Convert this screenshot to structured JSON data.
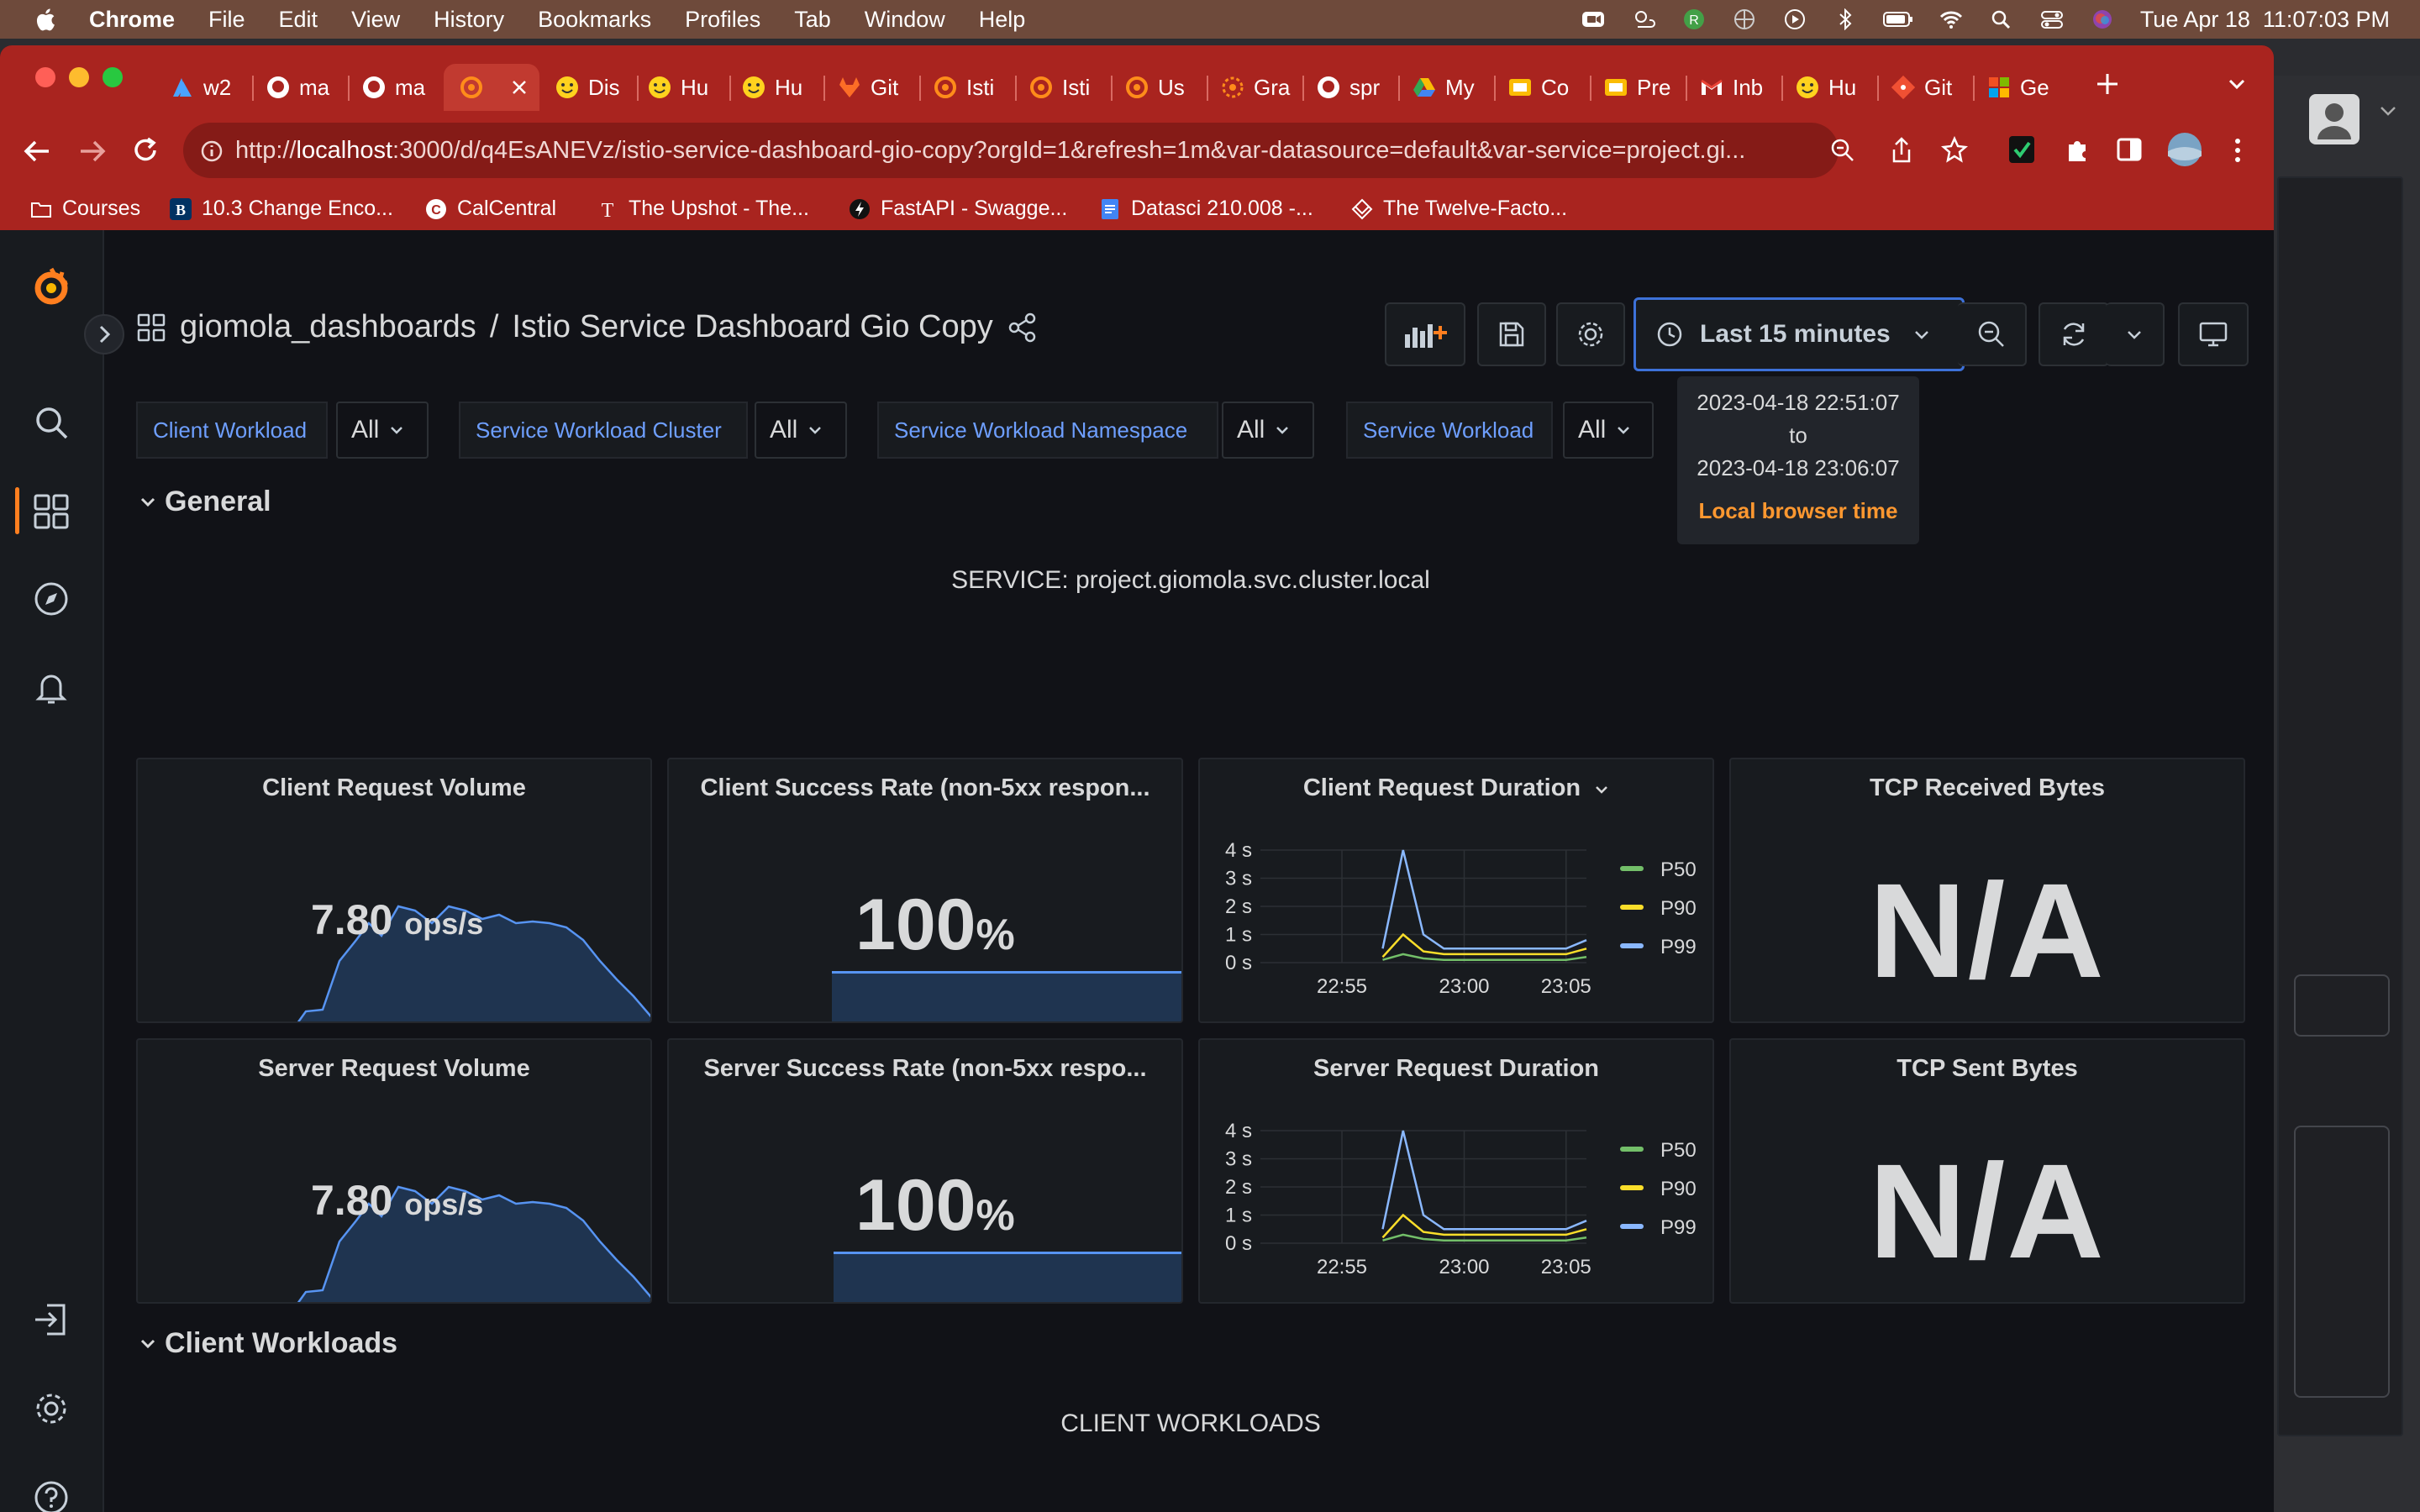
{
  "menubar": {
    "app": "Chrome",
    "items": [
      "File",
      "Edit",
      "View",
      "History",
      "Bookmarks",
      "Profiles",
      "Tab",
      "Window",
      "Help"
    ],
    "status_icons": [
      "zoom-icon",
      "weather-icon",
      "user-r-icon",
      "vpn-icon",
      "play-icon",
      "bluetooth-icon",
      "battery-icon",
      "wifi-icon",
      "spotlight-icon",
      "control-center-icon",
      "siri-icon"
    ],
    "datetime": "Tue Apr 18  11:07:03 PM"
  },
  "tabs": [
    {
      "label": "w2",
      "icon": "azure-icon"
    },
    {
      "label": "ma",
      "icon": "github-icon"
    },
    {
      "label": "ma",
      "icon": "github-icon"
    },
    {
      "label": "",
      "icon": "grafana-icon",
      "active": true
    },
    {
      "label": "Dis",
      "icon": "huggingface-icon"
    },
    {
      "label": "Hu",
      "icon": "huggingface-icon"
    },
    {
      "label": "Hu",
      "icon": "huggingface-icon"
    },
    {
      "label": "Git",
      "icon": "gitlab-icon"
    },
    {
      "label": "Isti",
      "icon": "grafana-icon"
    },
    {
      "label": "Isti",
      "icon": "grafana-icon"
    },
    {
      "label": "Us",
      "icon": "grafana-icon"
    },
    {
      "label": "Gra",
      "icon": "grafana-icon"
    },
    {
      "label": "spr",
      "icon": "github-icon"
    },
    {
      "label": "My",
      "icon": "drive-icon"
    },
    {
      "label": "Co",
      "icon": "slides-icon"
    },
    {
      "label": "Pre",
      "icon": "slides-icon"
    },
    {
      "label": "Inb",
      "icon": "gmail-icon"
    },
    {
      "label": "Hu",
      "icon": "huggingface-icon"
    },
    {
      "label": "Git",
      "icon": "git-icon"
    },
    {
      "label": "Ge",
      "icon": "microsoft-icon"
    }
  ],
  "url": {
    "prefix": "http://",
    "host": "localhost",
    "rest": ":3000/d/q4EsANEVz/istio-service-dashboard-gio-copy?orgId=1&refresh=1m&var-datasource=default&var-service=project.gi..."
  },
  "bookmarks": [
    {
      "label": "Courses",
      "icon": "folder-icon"
    },
    {
      "label": "10.3 Change Enco...",
      "icon": "berkeley-icon"
    },
    {
      "label": "CalCentral",
      "icon": "calcentral-icon"
    },
    {
      "label": "The Upshot - The...",
      "icon": "nyt-icon"
    },
    {
      "label": "FastAPI - Swagge...",
      "icon": "fastapi-icon"
    },
    {
      "label": "Datasci 210.008 -...",
      "icon": "docs-icon"
    },
    {
      "label": "The Twelve-Facto...",
      "icon": "twelve-factor-icon"
    }
  ],
  "dashboard": {
    "folder": "giomola_dashboards",
    "separator": "/",
    "title": "Istio Service Dashboard Gio Copy",
    "time_range": "Last 15 minutes",
    "tooltip": {
      "from": "2023-04-18 22:51:07",
      "to_word": "to",
      "to": "2023-04-18 23:06:07",
      "tz": "Local browser time"
    }
  },
  "variables": [
    {
      "label": "Client Workload",
      "value": "All"
    },
    {
      "label": "Service Workload Cluster",
      "value": "All"
    },
    {
      "label": "Service Workload Namespace",
      "value": "All"
    },
    {
      "label": "Service Workload",
      "value": "All"
    }
  ],
  "rows": {
    "general": "General",
    "client_workloads": "Client Workloads"
  },
  "service_text": "SERVICE: project.giomola.svc.cluster.local",
  "client_workloads_text": "CLIENT WORKLOADS",
  "panels": {
    "client_request_volume": {
      "title": "Client Request Volume",
      "value": "7.80",
      "unit": "ops/s"
    },
    "client_success_rate": {
      "title": "Client Success Rate (non-5xx respon...",
      "value": "100",
      "unit": "%"
    },
    "client_request_duration": {
      "title": "Client Request Duration"
    },
    "tcp_received": {
      "title": "TCP Received Bytes",
      "value": "N/A"
    },
    "server_request_volume": {
      "title": "Server Request Volume",
      "value": "7.80",
      "unit": "ops/s"
    },
    "server_success_rate": {
      "title": "Server Success Rate (non-5xx respo...",
      "value": "100",
      "unit": "%"
    },
    "server_request_duration": {
      "title": "Server Request Duration"
    },
    "tcp_sent": {
      "title": "TCP Sent Bytes",
      "value": "N/A"
    }
  },
  "colors": {
    "accent": "#3d71d9",
    "p50": "#73bf69",
    "p90": "#fade2a",
    "p99": "#8ab8ff",
    "sparkline": "#5794f2",
    "tooltip_tz": "#ff9830",
    "chrome_tabbar": "#a9241f"
  },
  "chart_data": [
    {
      "type": "line",
      "title": "Client Request Duration",
      "x": [
        "22:51",
        "22:52",
        "22:53",
        "22:54",
        "22:55",
        "22:56",
        "22:57",
        "22:57:30",
        "22:58",
        "22:59",
        "23:00",
        "23:01",
        "23:02",
        "23:03",
        "23:04",
        "23:05",
        "23:06"
      ],
      "x_ticks": [
        "22:55",
        "23:00",
        "23:05"
      ],
      "y_ticks": [
        "0 s",
        "1 s",
        "2 s",
        "3 s",
        "4 s"
      ],
      "ylim": [
        0,
        4
      ],
      "series": [
        {
          "name": "P50",
          "values": [
            null,
            null,
            null,
            null,
            null,
            null,
            0.1,
            0.3,
            0.15,
            0.1,
            0.1,
            0.1,
            0.1,
            0.1,
            0.1,
            0.1,
            0.2
          ]
        },
        {
          "name": "P90",
          "values": [
            null,
            null,
            null,
            null,
            null,
            null,
            0.2,
            1.0,
            0.4,
            0.3,
            0.3,
            0.3,
            0.3,
            0.3,
            0.3,
            0.3,
            0.5
          ]
        },
        {
          "name": "P99",
          "values": [
            null,
            null,
            null,
            null,
            null,
            null,
            0.5,
            4.0,
            1.0,
            0.5,
            0.5,
            0.5,
            0.5,
            0.5,
            0.5,
            0.5,
            0.8
          ]
        }
      ]
    },
    {
      "type": "line",
      "title": "Server Request Duration",
      "x": [
        "22:51",
        "22:52",
        "22:53",
        "22:54",
        "22:55",
        "22:56",
        "22:57",
        "22:57:30",
        "22:58",
        "22:59",
        "23:00",
        "23:01",
        "23:02",
        "23:03",
        "23:04",
        "23:05",
        "23:06"
      ],
      "x_ticks": [
        "22:55",
        "23:00",
        "23:05"
      ],
      "y_ticks": [
        "0 s",
        "1 s",
        "2 s",
        "3 s",
        "4 s"
      ],
      "ylim": [
        0,
        4
      ],
      "series": [
        {
          "name": "P50",
          "values": [
            null,
            null,
            null,
            null,
            null,
            null,
            0.1,
            0.3,
            0.15,
            0.1,
            0.1,
            0.1,
            0.1,
            0.1,
            0.1,
            0.1,
            0.2
          ]
        },
        {
          "name": "P90",
          "values": [
            null,
            null,
            null,
            null,
            null,
            null,
            0.2,
            1.0,
            0.4,
            0.3,
            0.3,
            0.3,
            0.3,
            0.3,
            0.3,
            0.3,
            0.5
          ]
        },
        {
          "name": "P99",
          "values": [
            null,
            null,
            null,
            null,
            null,
            null,
            0.5,
            4.0,
            1.0,
            0.5,
            0.5,
            0.5,
            0.5,
            0.5,
            0.5,
            0.5,
            0.8
          ]
        }
      ]
    }
  ]
}
